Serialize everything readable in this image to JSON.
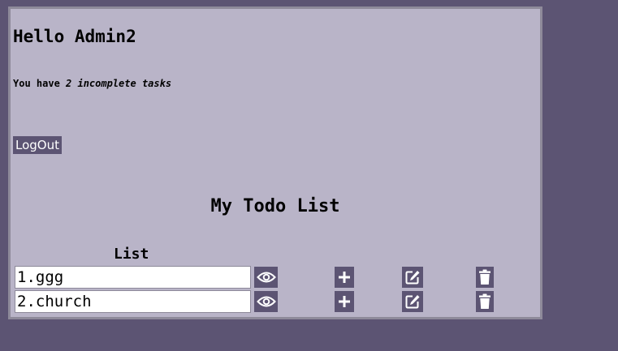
{
  "greeting": "Hello Admin2",
  "summary": {
    "prefix": "You have ",
    "emphasis": "2 incomplete tasks"
  },
  "logout_label": "LogOut",
  "todo_title": "My Todo List",
  "list_header": "List",
  "tasks": [
    {
      "label": "1.ggg"
    },
    {
      "label": "2.church"
    }
  ],
  "icons": {
    "view": "eye-icon",
    "add": "plus-icon",
    "edit": "edit-icon",
    "delete": "trash-icon"
  },
  "colors": {
    "page_background": "#5c5473",
    "panel_background": "#b9b4c8",
    "button_background": "#5c5473",
    "button_text": "#ffffff"
  }
}
